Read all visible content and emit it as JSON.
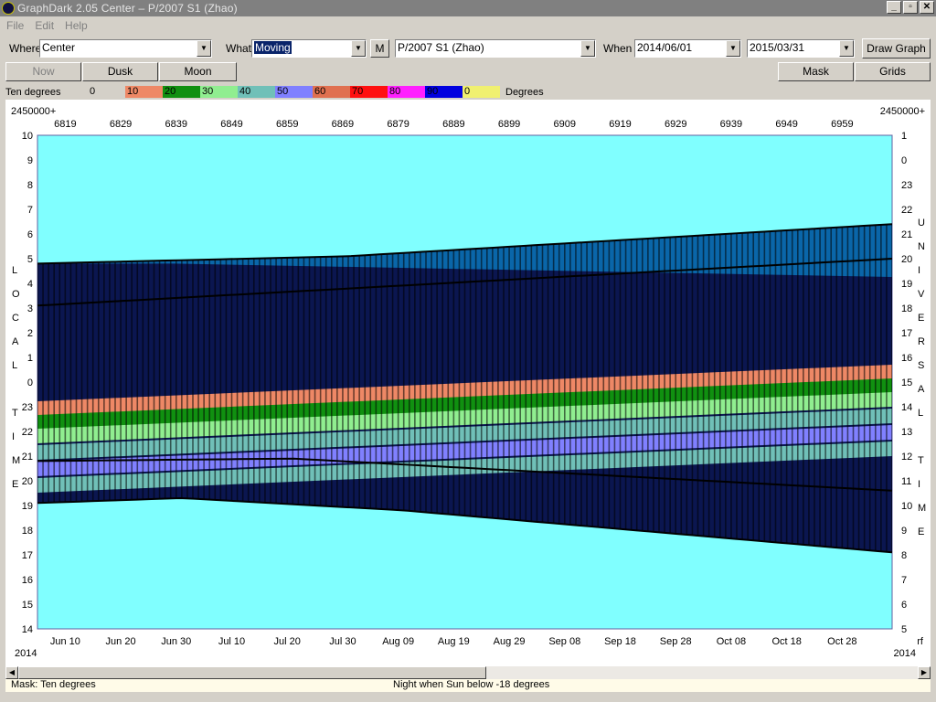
{
  "window": {
    "title": "GraphDark 2.05  Center  –  P/2007 S1 (Zhao)",
    "min": "_",
    "restore": "▫",
    "close": "✕"
  },
  "menu": {
    "file": "File",
    "edit": "Edit",
    "help": "Help"
  },
  "toolbar": {
    "where_label": "Where",
    "where_value": "Center",
    "what_label": "What",
    "what_value": "Moving",
    "m_button": "M",
    "object_value": "P/2007 S1 (Zhao)",
    "when_label": "When",
    "start_date": "2014/06/01",
    "end_date": "2015/03/31",
    "draw_button": "Draw Graph"
  },
  "toolbar2": {
    "now": "Now",
    "dusk": "Dusk",
    "moon": "Moon",
    "mask": "Mask",
    "grids": "Grids"
  },
  "legend": {
    "name": "Ten degrees",
    "unit": "Degrees",
    "items": [
      {
        "label": "0",
        "color": "#d4d0c8"
      },
      {
        "label": "10",
        "color": "#ee8866"
      },
      {
        "label": "20",
        "color": "#109010"
      },
      {
        "label": "30",
        "color": "#90ee90"
      },
      {
        "label": "40",
        "color": "#70c0b8"
      },
      {
        "label": "50",
        "color": "#8080ff"
      },
      {
        "label": "60",
        "color": "#e07050"
      },
      {
        "label": "70",
        "color": "#ff1010"
      },
      {
        "label": "80",
        "color": "#ff20ff"
      },
      {
        "label": "90",
        "color": "#0000e0"
      },
      {
        "label": "0",
        "color": "#f0f070"
      }
    ]
  },
  "chart_data": {
    "type": "heatmap",
    "title": "",
    "top_axis": {
      "prefix_left": "2450000+",
      "prefix_right": "2450000+",
      "ticks": [
        "6819",
        "6829",
        "6839",
        "6849",
        "6859",
        "6869",
        "6879",
        "6889",
        "6899",
        "6909",
        "6919",
        "6929",
        "6939",
        "6949",
        "6959"
      ]
    },
    "bottom_axis": {
      "ticks": [
        "Jun 10",
        "Jun 20",
        "Jun 30",
        "Jul 10",
        "Jul 20",
        "Jul 30",
        "Aug 09",
        "Aug 19",
        "Aug 29",
        "Sep 08",
        "Sep 18",
        "Sep 28",
        "Oct 08",
        "Oct 18",
        "Oct 28"
      ],
      "year_left": "2014",
      "year_right": "2014",
      "right_note": "rf"
    },
    "left_axis": {
      "title_letters": [
        "L",
        "O",
        "C",
        "A",
        "L",
        "",
        "T",
        "I",
        "M",
        "E"
      ],
      "ticks": [
        "10",
        "9",
        "8",
        "7",
        "6",
        "5",
        "4",
        "3",
        "2",
        "1",
        "0",
        "23",
        "22",
        "21",
        "20",
        "19",
        "18",
        "17",
        "16",
        "15",
        "14"
      ]
    },
    "right_axis": {
      "title_letters": [
        "U",
        "N",
        "I",
        "V",
        "E",
        "R",
        "S",
        "A",
        "L",
        "",
        "T",
        "I",
        "M",
        "E"
      ],
      "ticks": [
        "1",
        "0",
        "23",
        "22",
        "21",
        "20",
        "19",
        "18",
        "17",
        "16",
        "15",
        "14",
        "13",
        "12",
        "11",
        "10",
        "9",
        "8",
        "7",
        "6",
        "5"
      ]
    },
    "x_range_days": [
      6814,
      6968
    ],
    "night_boundaries": {
      "dusk_local_hours": [
        {
          "day": 6814,
          "value": 4.8
        },
        {
          "day": 6870,
          "value": 5.1
        },
        {
          "day": 6968,
          "value": 6.4
        }
      ],
      "dawn_local_hours": [
        {
          "day": 6814,
          "value": 19.1
        },
        {
          "day": 6840,
          "value": 19.3
        },
        {
          "day": 6880,
          "value": 18.8
        },
        {
          "day": 6968,
          "value": 17.1
        }
      ]
    },
    "grid": false
  },
  "status": {
    "mask": "Mask:  Ten degrees",
    "night": "Night when Sun below -18 degrees"
  }
}
